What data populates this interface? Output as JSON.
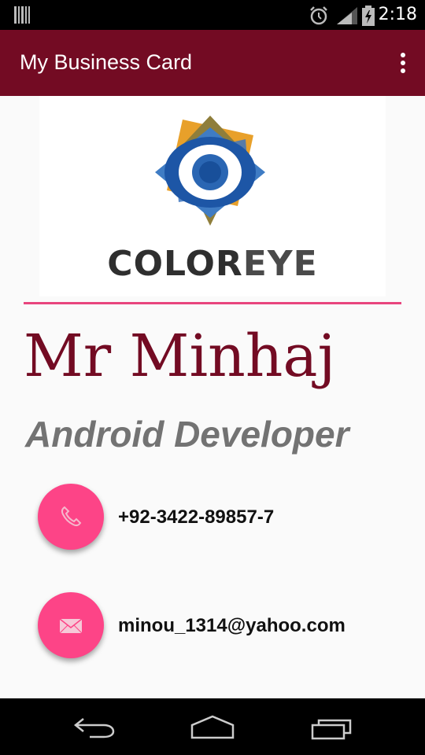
{
  "status_bar": {
    "time": "2:18"
  },
  "app_bar": {
    "title": "My Business Card"
  },
  "logo": {
    "text_part1": "COLOR",
    "text_part2": "EYE"
  },
  "profile": {
    "name": "Mr Minhaj",
    "role": "Android Developer"
  },
  "contacts": {
    "phone": "+92-3422-89857-7",
    "email": "minou_1314@yahoo.com"
  },
  "colors": {
    "app_bar": "#730b23",
    "accent_pink": "#fd4487",
    "divider": "#e8457d",
    "name_text": "#730b23",
    "role_text": "#737373"
  },
  "icons": {
    "status": [
      "barcode-icon",
      "alarm-icon",
      "signal-icon",
      "battery-charging-icon"
    ],
    "app_bar": [
      "overflow-menu-icon"
    ],
    "contacts": [
      "phone-icon",
      "mail-icon"
    ],
    "nav": [
      "back-icon",
      "home-icon",
      "recents-icon"
    ]
  }
}
